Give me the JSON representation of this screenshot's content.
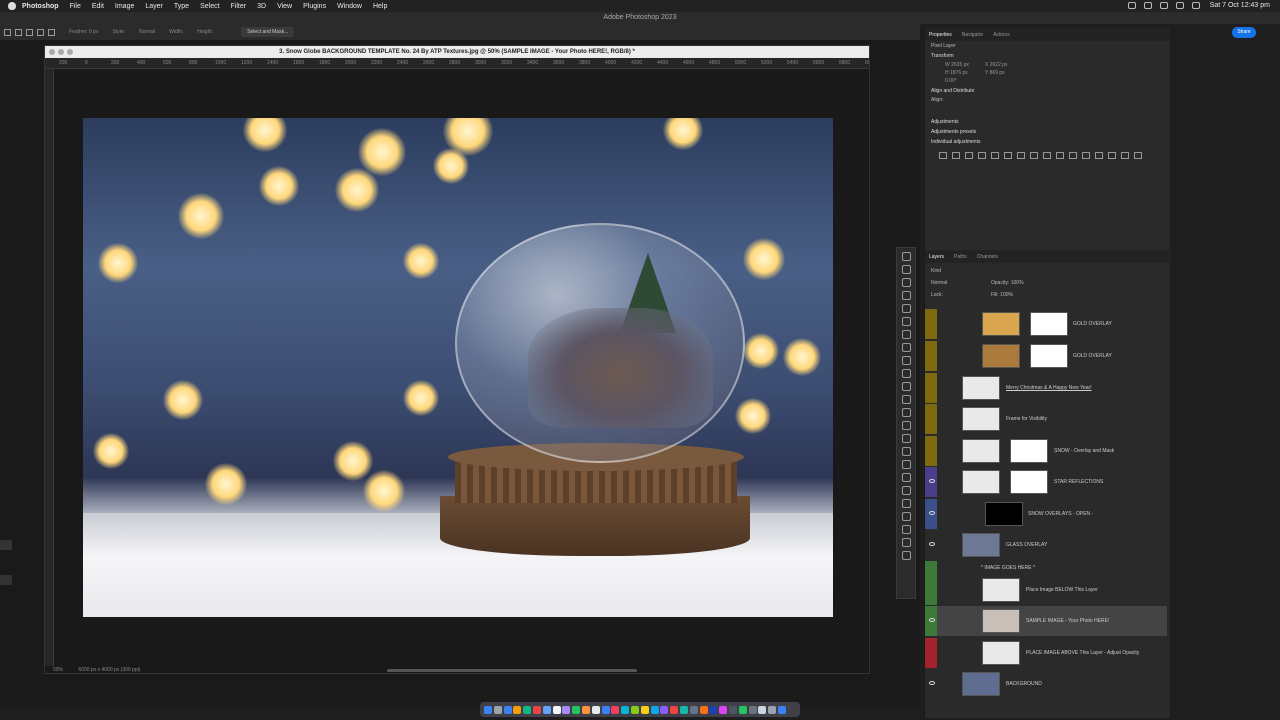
{
  "menubar": {
    "app": "Photoshop",
    "items": [
      "File",
      "Edit",
      "Image",
      "Layer",
      "Type",
      "Select",
      "Filter",
      "3D",
      "View",
      "Plugins",
      "Window",
      "Help"
    ],
    "clock": "Sat 7 Oct  12:43 pm"
  },
  "app_title": "Adobe Photoshop 2023",
  "options": {
    "feather": "Feather:  0 px",
    "style_label": "Style:",
    "style_value": "Normal",
    "width": "Width:",
    "height": "Height:",
    "select_mask": "Select and Mask..."
  },
  "share": "Share",
  "document": {
    "title": "3. Snow Globe BACKGROUND TEMPLATE No. 24 By ATP Textures.jpg @ 50% (SAMPLE IMAGE - Your Photo HERE!, RGB/8) *",
    "ruler_ticks": [
      "200",
      "0",
      "200",
      "400",
      "600",
      "800",
      "1000",
      "1200",
      "1400",
      "1600",
      "1800",
      "2000",
      "2200",
      "2400",
      "2600",
      "2800",
      "3000",
      "3200",
      "3400",
      "3600",
      "3800",
      "4000",
      "4200",
      "4400",
      "4600",
      "4800",
      "5000",
      "5200",
      "5400",
      "5600",
      "5800",
      "6000",
      "62"
    ],
    "zoom": "50%",
    "doc_size": "6000 px x 4000 px (300 ppi)"
  },
  "panel": {
    "tabs": [
      "Properties",
      "Navigator",
      "Actions"
    ],
    "pixel_layer": "Pixel Layer",
    "transform": "Transform",
    "w": "W  2635 px",
    "x": "X  2622 px",
    "h": "H  1876 px",
    "y": "Y  869 px",
    "angle": "0.00°",
    "align": "Align and Distribute",
    "align_sub": "Align:",
    "adjustments": "Adjustments",
    "adj_presets": "Adjustments presets",
    "individual": "Individual adjustments",
    "layer_tabs": [
      "Layers",
      "Paths",
      "Channels"
    ],
    "kind": "Kind",
    "blend": "Normal",
    "opacity": "Opacity:  100%",
    "lock": "Lock:",
    "fill": "Fill:  100%"
  },
  "layers": [
    {
      "name": "GOLD OVERLAY",
      "color": "#7d6a10"
    },
    {
      "name": "GOLD OVERLAY",
      "color": "#7d6a10"
    },
    {
      "name": "Merry Christmas & A Happy New Year!",
      "color": "#7d6a10"
    },
    {
      "name": "Frame for Visibility",
      "color": "#7d6a10"
    },
    {
      "name": "SNOW - Overlay and Mask",
      "color": "#7d6a10"
    },
    {
      "name": "STAR REFLECTIONS",
      "color": "#4b3d8a"
    },
    {
      "name": "SNOW OVERLAYS - OPEN -",
      "color": "#3b4f8a"
    },
    {
      "name": "GLASS OVERLAY",
      "color": "#2a2a2a"
    },
    {
      "name": "* IMAGE GOES HERE *",
      "color": "#3d7a3a"
    },
    {
      "name": "Place Image BELOW This Layer",
      "color": "#3d7a3a"
    },
    {
      "name": "SAMPLE IMAGE - Your Photo HERE!",
      "color": "#3d7a3a"
    },
    {
      "name": "PLACE IMAGE ABOVE This Layer - Adjust Opacity",
      "color": "#a3222b"
    },
    {
      "name": "BACKGROUND",
      "color": "#2a2a2a"
    }
  ]
}
